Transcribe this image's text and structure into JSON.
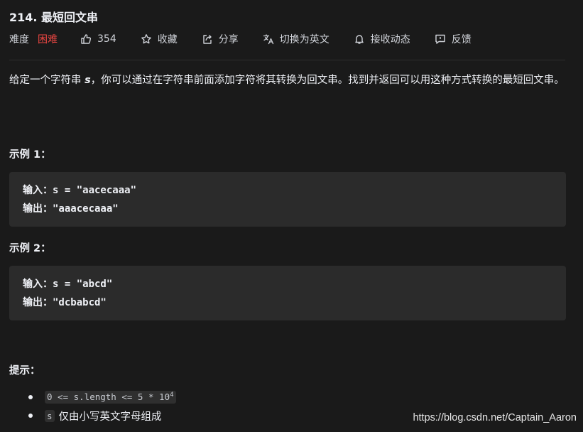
{
  "problem": {
    "title": "214. 最短回文串"
  },
  "meta": {
    "difficulty_label": "难度",
    "difficulty_value": "困难",
    "difficulty_color": "#ef4743",
    "likes": "354",
    "favorite_label": "收藏",
    "share_label": "分享",
    "switch_lang_label": "切换为英文",
    "subscribe_label": "接收动态",
    "feedback_label": "反馈",
    "icons": [
      "thumbs-up-icon",
      "star-icon",
      "share-icon",
      "translate-icon",
      "bell-icon",
      "feedback-icon"
    ]
  },
  "description": {
    "part1": "给定一个字符串 ",
    "var": "s",
    "part2": "，你可以通过在字符串前面添加字符将其转换为回文串。找到并返回可以用这种方式转换的最短回文串。"
  },
  "examples": [
    {
      "title": "示例 1：",
      "input_label": "输入：",
      "input_value": "s = \"aacecaaa\"",
      "output_label": "输出：",
      "output_value": "\"aaacecaaa\""
    },
    {
      "title": "示例 2：",
      "input_label": "输入：",
      "input_value": "s = \"abcd\"",
      "output_label": "输出：",
      "output_value": "\"dcbabcd\""
    }
  ],
  "hints": {
    "title": "提示：",
    "constraint_code": "0 <= s.length <= 5 * 10",
    "constraint_exp": "4",
    "item2_code": "s",
    "item2_text": "仅由小写英文字母组成"
  },
  "watermark": "https://blog.csdn.net/Captain_Aaron"
}
